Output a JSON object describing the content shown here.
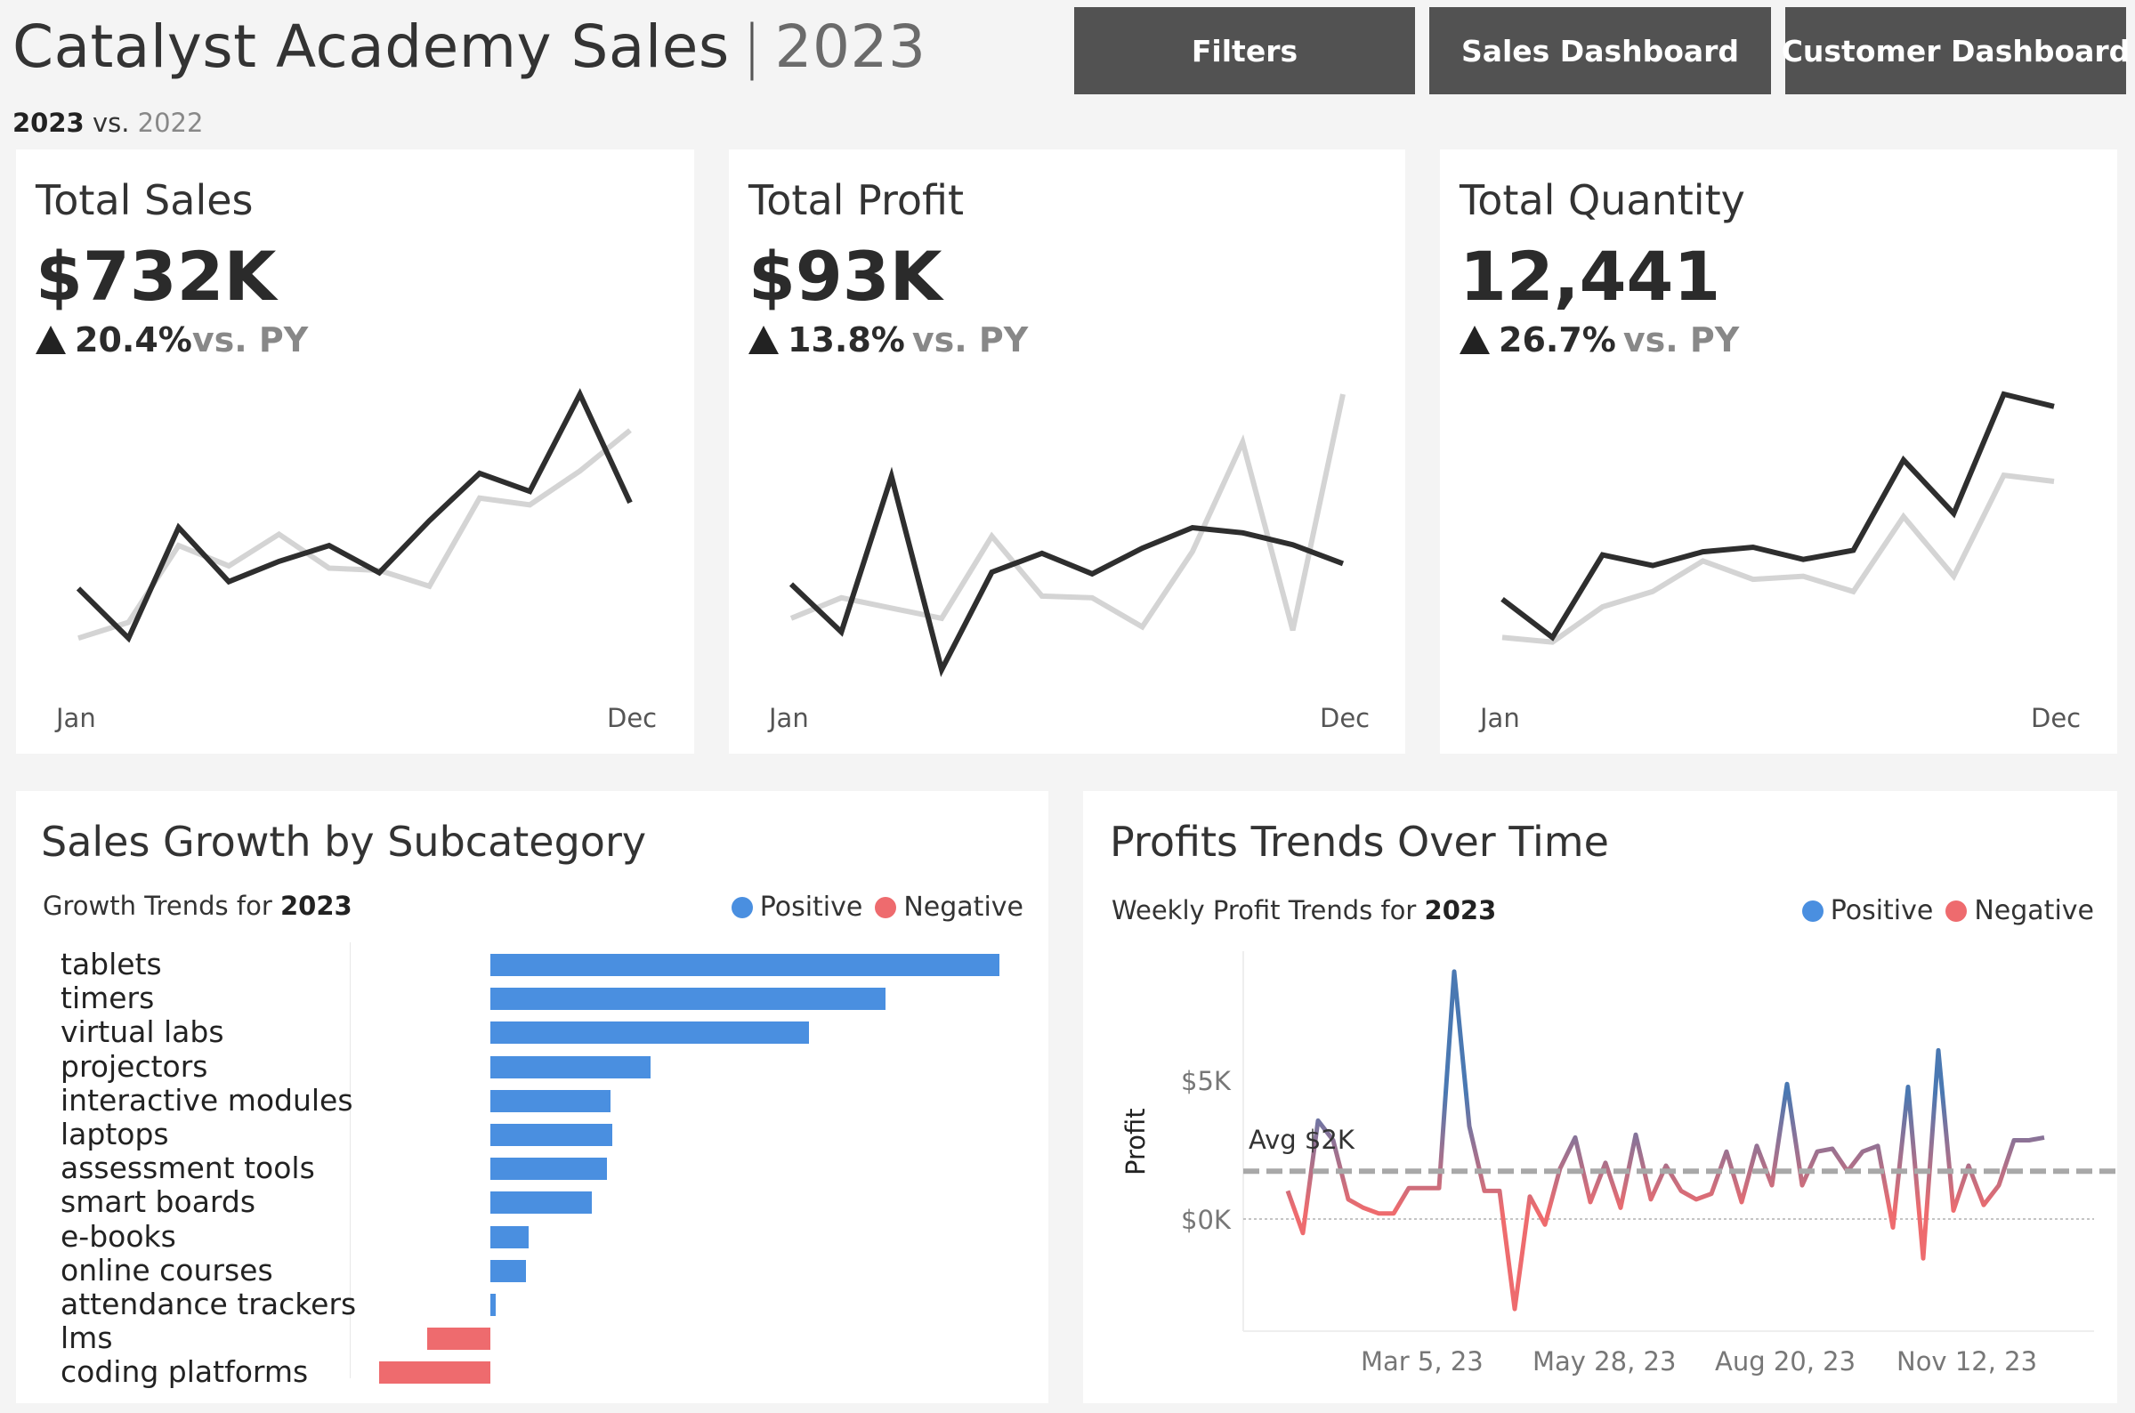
{
  "header": {
    "title": "Catalyst Academy Sales",
    "year": "2023",
    "compare_current": "2023",
    "compare_vs": "vs.",
    "compare_prior": "2022"
  },
  "nav": {
    "filters": "Filters",
    "sales_dashboard": "Sales Dashboard",
    "customer_dashboard": "Customer Dashboard"
  },
  "kpis": [
    {
      "title": "Total Sales",
      "value": "$732K",
      "delta": "20.4%",
      "delta_suffix": "vs. PY",
      "x_start": "Jan",
      "x_end": "Dec",
      "current": [
        42,
        20,
        69,
        45,
        54,
        61,
        49,
        72,
        93,
        85,
        128,
        80
      ],
      "prior": [
        20,
        27,
        61,
        52,
        66,
        51,
        50,
        43,
        82,
        79,
        94,
        112
      ]
    },
    {
      "title": "Total Profit",
      "value": "$93K",
      "delta": "13.8%",
      "delta_suffix": "vs. PY",
      "x_start": "Jan",
      "x_end": "Dec",
      "current": [
        58,
        30,
        121,
        8,
        65,
        76,
        64,
        79,
        91,
        88,
        81,
        70
      ],
      "prior": [
        38,
        50,
        44,
        38,
        86,
        51,
        50,
        33,
        77,
        141,
        31,
        169
      ]
    },
    {
      "title": "Total Quantity",
      "value": "12,441",
      "delta": "26.7%",
      "delta_suffix": "vs. PY",
      "x_start": "Jan",
      "x_end": "Dec",
      "current": [
        55,
        30,
        84,
        77,
        86,
        89,
        81,
        87,
        146,
        111,
        189,
        181
      ],
      "prior": [
        30,
        27,
        50,
        60,
        80,
        68,
        70,
        60,
        109,
        70,
        136,
        132
      ]
    }
  ],
  "growth": {
    "title": "Sales Growth by Subcategory",
    "subtitle_prefix": "Growth Trends for",
    "subtitle_year": "2023",
    "legend_positive": "Positive",
    "legend_negative": "Negative",
    "colors": {
      "positive": "#4a8fe0",
      "negative": "#ee6b6e"
    }
  },
  "chart_data": [
    {
      "type": "bar",
      "title": "Sales Growth by Subcategory",
      "subtitle": "Growth Trends for 2023",
      "categories": [
        "tablets",
        "timers",
        "virtual labs",
        "projectors",
        "interactive modules",
        "laptops",
        "assessment tools",
        "smart boards",
        "e-books",
        "online courses",
        "attendance trackers",
        "lms",
        "coding platforms"
      ],
      "values": [
        372,
        289,
        233,
        117,
        88,
        89,
        85,
        74,
        28,
        26,
        4,
        -46,
        -81
      ]
    },
    {
      "type": "line",
      "title": "Profits Trends Over Time",
      "subtitle": "Weekly Profit Trends for 2023",
      "ylabel": "Profit",
      "y_ticks": [
        "$5K",
        "$0K"
      ],
      "x_ticks": [
        "Mar 5, 23",
        "May 28, 23",
        "Aug 20, 23",
        "Nov 12, 23"
      ],
      "average": 1.7,
      "average_label": "Avg $2K",
      "x": [
        1,
        2,
        3,
        4,
        5,
        6,
        7,
        8,
        9,
        10,
        11,
        12,
        13,
        14,
        15,
        16,
        17,
        18,
        19,
        20,
        21,
        22,
        23,
        24,
        25,
        26,
        27,
        28,
        29,
        30,
        31,
        32,
        33,
        34,
        35,
        36,
        37,
        38,
        39,
        40,
        41,
        42,
        43,
        44,
        45,
        46,
        47,
        48,
        49,
        50,
        51
      ],
      "values": [
        1.0,
        -0.5,
        3.5,
        2.8,
        0.7,
        0.4,
        0.2,
        0.2,
        1.1,
        1.1,
        1.1,
        8.8,
        3.3,
        1.0,
        1.0,
        -3.2,
        0.8,
        -0.2,
        1.8,
        2.9,
        0.6,
        2.0,
        0.4,
        3.0,
        0.7,
        1.9,
        1.0,
        0.7,
        0.9,
        2.4,
        0.6,
        2.6,
        1.2,
        4.8,
        1.2,
        2.4,
        2.5,
        1.7,
        2.4,
        2.6,
        -0.3,
        4.7,
        -1.4,
        6.0,
        0.3,
        1.9,
        0.5,
        1.2,
        2.8,
        2.8,
        2.9
      ]
    }
  ],
  "profit": {
    "title": "Profits Trends Over Time",
    "subtitle_prefix": "Weekly Profit Trends for",
    "subtitle_year": "2023",
    "legend_positive": "Positive",
    "legend_negative": "Negative",
    "ylabel": "Profit",
    "y_tick_5k": "$5K",
    "y_tick_0k": "$0K",
    "avg_label": "Avg $2K",
    "x_ticks": [
      "Mar 5, 23",
      "May 28, 23",
      "Aug 20, 23",
      "Nov 12, 23"
    ],
    "colors": {
      "positive": "#4a78b2",
      "negative": "#ee6b6e",
      "avg": "#a8a8a8"
    }
  }
}
